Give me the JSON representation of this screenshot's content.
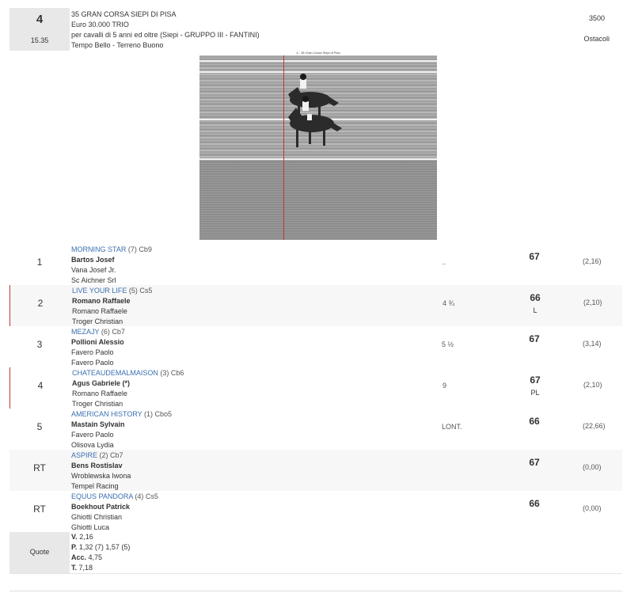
{
  "race": {
    "number": "4",
    "time": "15.35",
    "title": "35 GRAN CORSA SIEPI DI PISA",
    "prize": "Euro 30.000 TRIO",
    "conditions": "per cavalli di 5 anni ed oltre (Siepi -   GRUPPO III  - FANTINI)",
    "weather": "Tempo Bello - Terreno Buono",
    "distance": "3500",
    "type": "Ostacoli"
  },
  "photo": {
    "caption": "4 - 35 Gran Corsa Siepi di Pisa"
  },
  "runners": [
    {
      "pos": "1",
      "horse": "MORNING STAR",
      "meta": " (7) Cb9",
      "jockey": "Bartos Josef",
      "trainer": "Vana Josef Jr.",
      "owner": "Sc Aichner Srl",
      "dist": "..",
      "weight": "67",
      "weight_sub": "",
      "odds": "(2,16)"
    },
    {
      "pos": "2",
      "horse": "LIVE YOUR LIFE",
      "meta": " (5) Cs5",
      "jockey": "Romano Raffaele",
      "trainer": "Romano Raffaele",
      "owner": "Troger Christian",
      "dist": "4 ¾",
      "weight": "66",
      "weight_sub": "L",
      "odds": "(2,10)"
    },
    {
      "pos": "3",
      "horse": "MEZAJY",
      "meta": " (6) Cb7",
      "jockey": "Pollioni Alessio",
      "trainer": "Favero Paolo",
      "owner": "Favero Paolo",
      "dist": "5 ½",
      "weight": "67",
      "weight_sub": "",
      "odds": "(3,14)"
    },
    {
      "pos": "4",
      "horse": "CHATEAUDEMALMAISON",
      "meta": " (3) Cb6",
      "jockey": "Agus Gabriele (*)",
      "trainer": "Romano Raffaele",
      "owner": "Troger Christian",
      "dist": "9",
      "weight": "67",
      "weight_sub": "PL",
      "odds": "(2,10)"
    },
    {
      "pos": "5",
      "horse": "AMERICAN HISTORY",
      "meta": " (1) Cbo5",
      "jockey": "Mastain Sylvain",
      "trainer": "Favero Paolo",
      "owner": "Olisova Lydia",
      "dist": "LONT.",
      "weight": "66",
      "weight_sub": "",
      "odds": "(22,66)"
    },
    {
      "pos": "RT",
      "horse": "ASPIRE",
      "meta": " (2) Cb7",
      "jockey": "Bens Rostislav",
      "trainer": "Wroblewska Iwona",
      "owner": "Tempel Racing",
      "dist": "",
      "weight": "67",
      "weight_sub": "",
      "odds": "(0,00)"
    },
    {
      "pos": "RT",
      "horse": "EQUUS PANDORA",
      "meta": " (4) Cs5",
      "jockey": "Boekhout Patrick",
      "trainer": "Ghiotti Christian",
      "owner": "Ghiotti Luca",
      "dist": "",
      "weight": "66",
      "weight_sub": "",
      "odds": "(0,00)"
    }
  ],
  "quote": {
    "label": "Quote",
    "v_label": "V.",
    "v_value": " 2,16",
    "p_label": "P.",
    "p_value": " 1,32 (7)  1,57 (5)",
    "acc_label": "Acc.",
    "acc_value": " 4,75",
    "t_label": "T.",
    "t_value": " 7,18"
  }
}
